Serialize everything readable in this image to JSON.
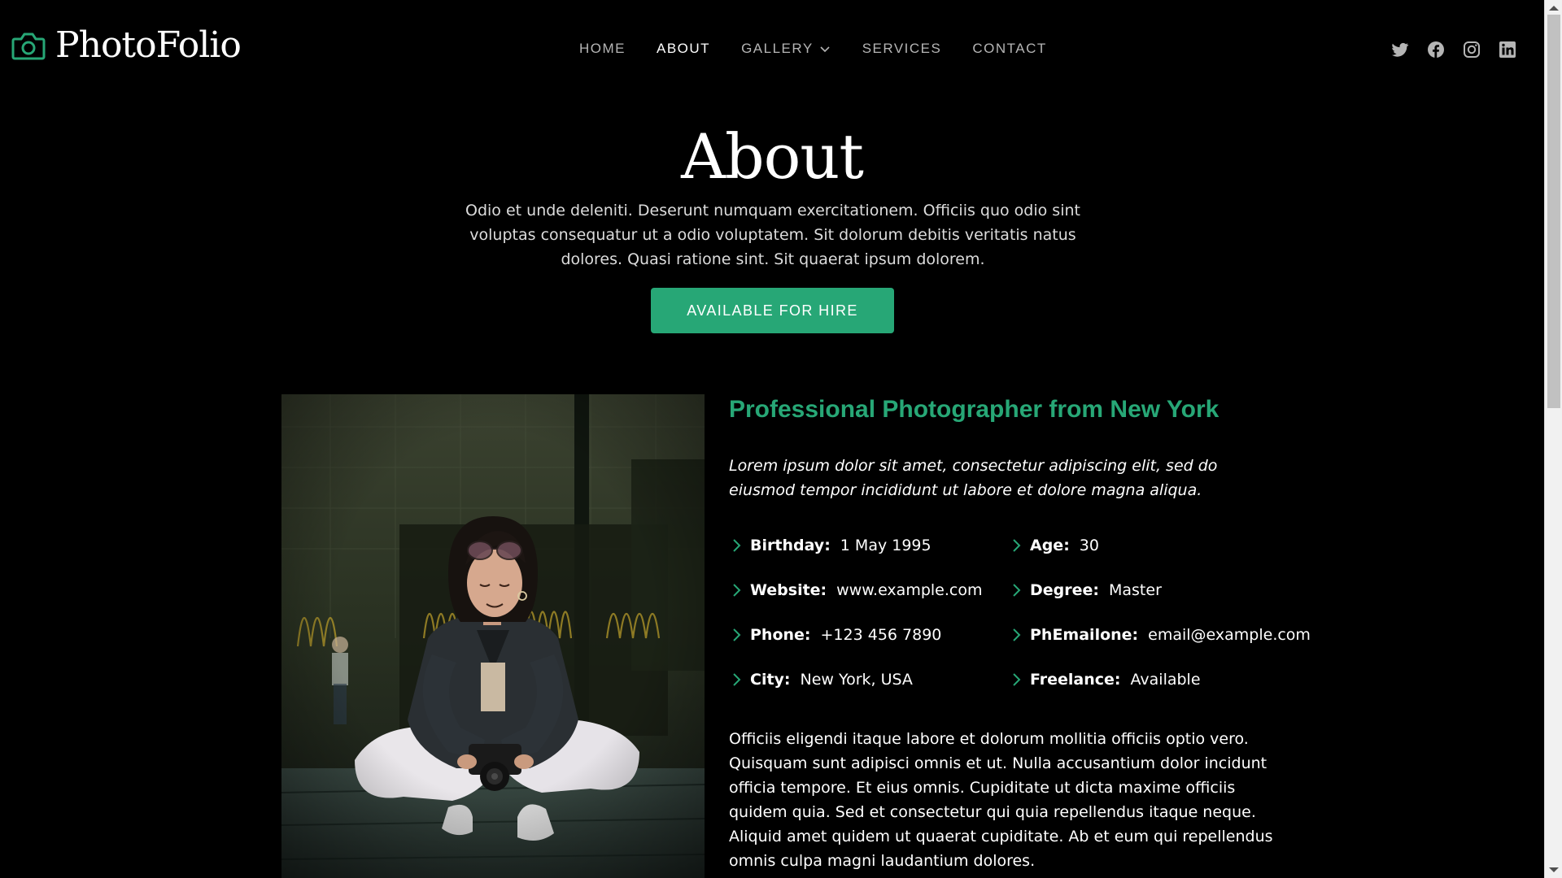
{
  "brand": {
    "name": "PhotoFolio",
    "accent": "#27a776"
  },
  "nav": {
    "items": [
      {
        "label": "HOME"
      },
      {
        "label": "ABOUT",
        "active": true
      },
      {
        "label": "GALLERY",
        "has_dropdown": true
      },
      {
        "label": "SERVICES"
      },
      {
        "label": "CONTACT"
      }
    ]
  },
  "social": {
    "icons": [
      "twitter-icon",
      "facebook-icon",
      "instagram-icon",
      "linkedin-icon"
    ]
  },
  "hero": {
    "title": "About",
    "text": "Odio et unde deleniti. Deserunt numquam exercitationem. Officiis quo odio sint voluptas consequatur ut a odio voluptatem. Sit dolorum debitis veritatis natus dolores. Quasi ratione sint. Sit quaerat ipsum dolorem.",
    "button_label": "AVAILABLE FOR HIRE"
  },
  "about": {
    "title": "Professional Photographer from New York",
    "lead": "Lorem ipsum dolor sit amet, consectetur adipiscing elit, sed do eiusmod tempor incididunt ut labore et dolore magna aliqua.",
    "facts": {
      "birthday": {
        "label": "Birthday:",
        "value": "1 May 1995"
      },
      "age": {
        "label": "Age:",
        "value": "30"
      },
      "website": {
        "label": "Website:",
        "value": "www.example.com"
      },
      "degree": {
        "label": "Degree:",
        "value": "Master"
      },
      "phone": {
        "label": "Phone:",
        "value": "+123 456 7890"
      },
      "email": {
        "label": "PhEmailone:",
        "value": "email@example.com"
      },
      "city": {
        "label": "City:",
        "value": "New York, USA"
      },
      "freelance": {
        "label": "Freelance:",
        "value": "Available"
      }
    },
    "body": "Officiis eligendi itaque labore et dolorum mollitia officiis optio vero. Quisquam sunt adipisci omnis et ut. Nulla accusantium dolor incidunt officia tempore. Et eius omnis. Cupiditate ut dicta maxime officiis quidem quia. Sed et consectetur qui quia repellendus itaque neque. Aliquid amet quidem ut quaerat cupiditate. Ab et eum qui repellendus omnis culpa magni laudantium dolores."
  }
}
